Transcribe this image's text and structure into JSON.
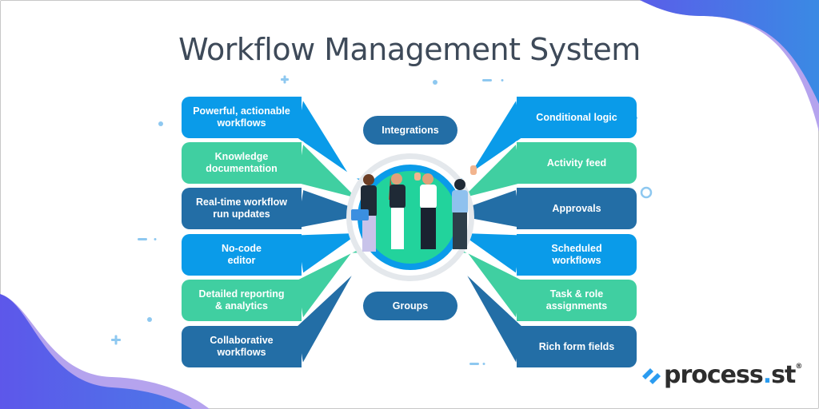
{
  "title": "Workflow Management System",
  "colors": {
    "blue": "#0a9be9",
    "green": "#40cfa1",
    "navy": "#236ea6",
    "title": "#3e4a59",
    "accent_purple": "#5b5be8",
    "lavender": "#b5a3ee"
  },
  "center": {
    "top_pill": "Integrations",
    "bottom_pill": "Groups",
    "illustration": "team-illustration"
  },
  "left_features": [
    {
      "label": "Powerful, actionable\nworkflows",
      "color": "blue"
    },
    {
      "label": "Knowledge\ndocumentation",
      "color": "green"
    },
    {
      "label": "Real-time workflow\nrun updates",
      "color": "navy"
    },
    {
      "label": "No-code\neditor",
      "color": "blue"
    },
    {
      "label": "Detailed reporting\n& analytics",
      "color": "green"
    },
    {
      "label": "Collaborative\nworkflows",
      "color": "navy"
    }
  ],
  "right_features": [
    {
      "label": "Conditional logic",
      "color": "blue"
    },
    {
      "label": "Activity feed",
      "color": "green"
    },
    {
      "label": "Approvals",
      "color": "navy"
    },
    {
      "label": "Scheduled\nworkflows",
      "color": "blue"
    },
    {
      "label": "Task & role\nassignments",
      "color": "green"
    },
    {
      "label": "Rich form fields",
      "color": "navy"
    }
  ],
  "logo": {
    "name_part1": "process",
    "dot": ".",
    "name_part2": "st",
    "registered": "®"
  }
}
